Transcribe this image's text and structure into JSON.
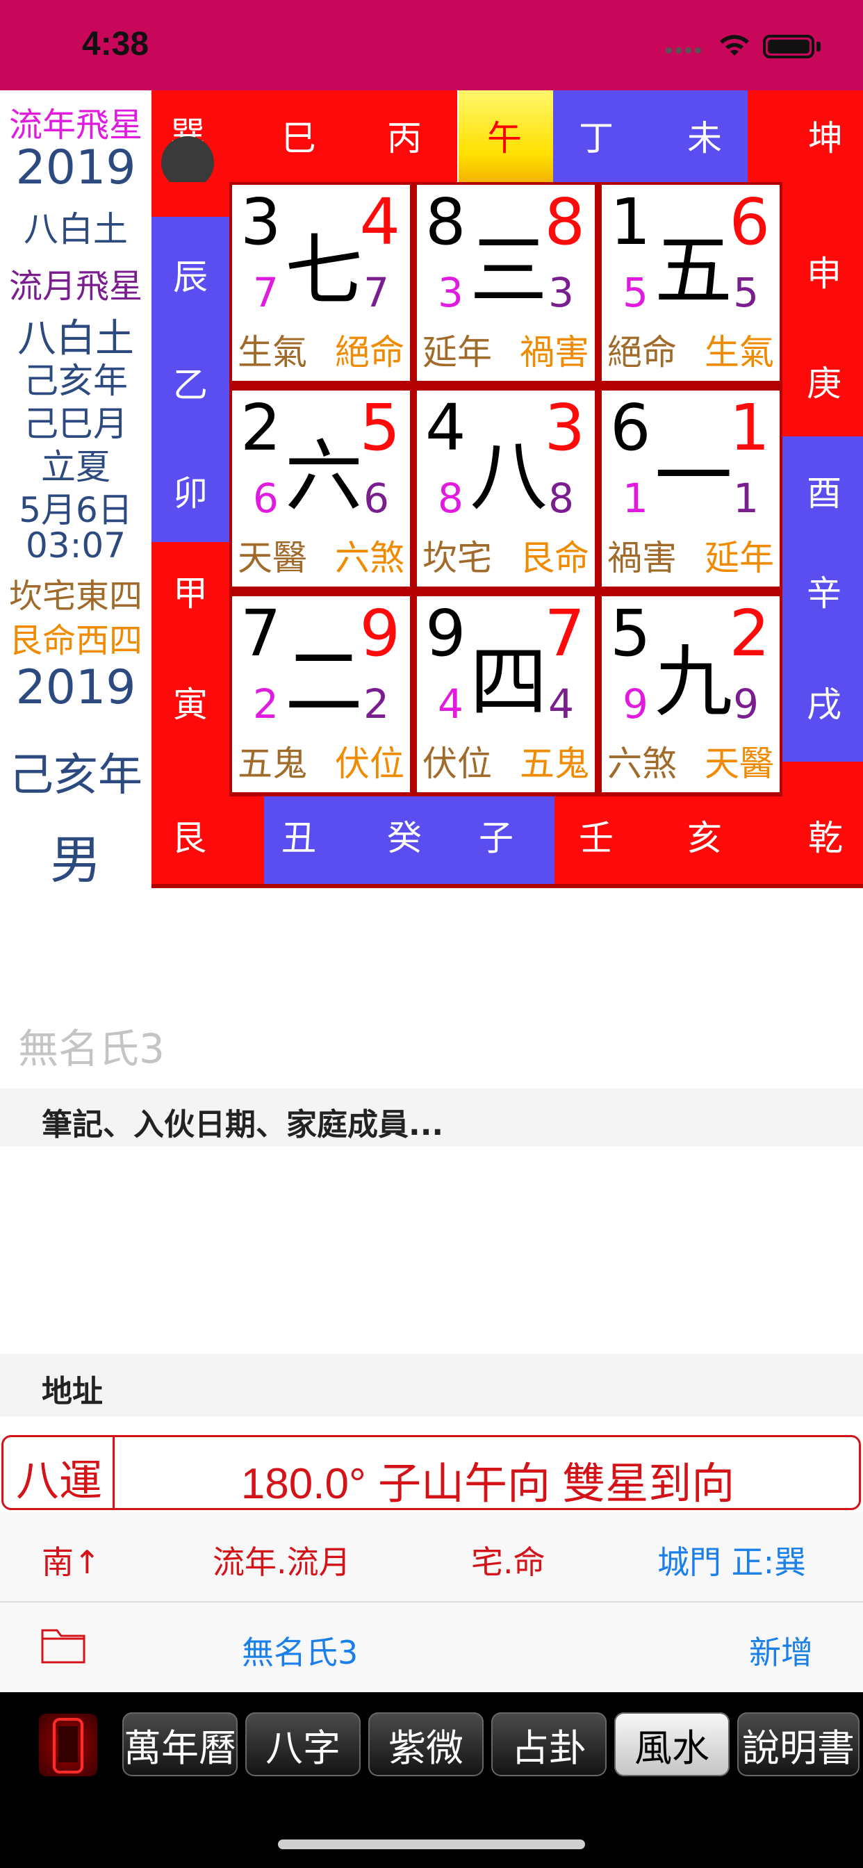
{
  "status": {
    "time": "4:38"
  },
  "left_panel": {
    "year_star_title": "流年飛星",
    "year_number": "2019",
    "year_star": "八白土",
    "month_star_title": "流月飛星",
    "month_star": "八白土",
    "year_ganzhi": "己亥年",
    "month_ganzhi": "己巳月",
    "solar_term": "立夏",
    "date": "5月6日",
    "clock": "03:07",
    "house_group": "坎宅東四",
    "life_group": "艮命西四",
    "birth_year": "2019",
    "birth_ganzhi": "己亥年",
    "gender": "男"
  },
  "compass": {
    "top": [
      "巽",
      "巳",
      "丙",
      "午",
      "丁",
      "未",
      "坤"
    ],
    "right": [
      "申",
      "庚",
      "酉",
      "辛",
      "戌"
    ],
    "bottom": [
      "艮",
      "丑",
      "癸",
      "子",
      "壬",
      "亥",
      "乾"
    ],
    "left": [
      "辰",
      "乙",
      "卯",
      "甲",
      "寅"
    ]
  },
  "grid": [
    {
      "mountain": "3",
      "water": "4",
      "center": "七",
      "year": "7",
      "month": "7",
      "left_label": "生氣",
      "right_label": "絕命"
    },
    {
      "mountain": "8",
      "water": "8",
      "center": "三",
      "year": "3",
      "month": "3",
      "left_label": "延年",
      "right_label": "禍害"
    },
    {
      "mountain": "1",
      "water": "6",
      "center": "五",
      "year": "5",
      "month": "5",
      "left_label": "絕命",
      "right_label": "生氣"
    },
    {
      "mountain": "2",
      "water": "5",
      "center": "六",
      "year": "6",
      "month": "6",
      "left_label": "天醫",
      "right_label": "六煞"
    },
    {
      "mountain": "4",
      "water": "3",
      "center": "八",
      "year": "8",
      "month": "8",
      "left_label": "坎宅",
      "right_label": "艮命"
    },
    {
      "mountain": "6",
      "water": "1",
      "center": "一",
      "year": "1",
      "month": "1",
      "left_label": "禍害",
      "right_label": "延年"
    },
    {
      "mountain": "7",
      "water": "9",
      "center": "二",
      "year": "2",
      "month": "2",
      "left_label": "五鬼",
      "right_label": "伏位"
    },
    {
      "mountain": "9",
      "water": "7",
      "center": "四",
      "year": "4",
      "month": "4",
      "left_label": "伏位",
      "right_label": "五鬼"
    },
    {
      "mountain": "5",
      "water": "2",
      "center": "九",
      "year": "9",
      "month": "9",
      "left_label": "六煞",
      "right_label": "天醫"
    }
  ],
  "form": {
    "name_placeholder": "無名氏3",
    "notes_header": "筆記、入伙日期、家庭成員...",
    "address_header": "地址"
  },
  "direction": {
    "period": "八運",
    "reading": "180.0° 子山午向 雙星到向"
  },
  "options": {
    "south_up": "南↑",
    "year_month": "流年.流月",
    "house_life": "宅.命",
    "gate": "城門 正:巽"
  },
  "file_row": {
    "record_name": "無名氏3",
    "add": "新增"
  },
  "tabs": [
    "萬年曆",
    "八字",
    "紫微",
    "占卦",
    "風水",
    "說明書"
  ],
  "active_tab": "風水",
  "colors": {
    "status_bar": "#c8075a",
    "red": "#ff0a0a",
    "blue": "#5a4ef0",
    "magenta": "#e11ae0",
    "purple": "#7a1d8f",
    "orange": "#f08a00",
    "brown": "#a06a2a",
    "link_blue": "#1a7fe8"
  }
}
